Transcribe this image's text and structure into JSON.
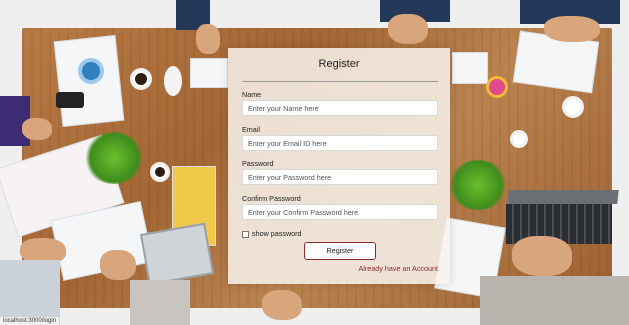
{
  "form": {
    "title": "Register",
    "fields": [
      {
        "label": "Name",
        "placeholder": "Enter your Name here"
      },
      {
        "label": "Email",
        "placeholder": "Enter your Email ID here"
      },
      {
        "label": "Password",
        "placeholder": "Enter your Password here"
      },
      {
        "label": "Confirm Password",
        "placeholder": "Enter your Confirm Password here"
      }
    ],
    "show_password_label": "show password",
    "show_password_checked": false,
    "submit_label": "Register",
    "login_link": "Already have an Account"
  },
  "status_bar": {
    "url": "localhost:3000/login"
  },
  "colors": {
    "accent": "#8b2c2c",
    "card": "#f8f2ee"
  }
}
